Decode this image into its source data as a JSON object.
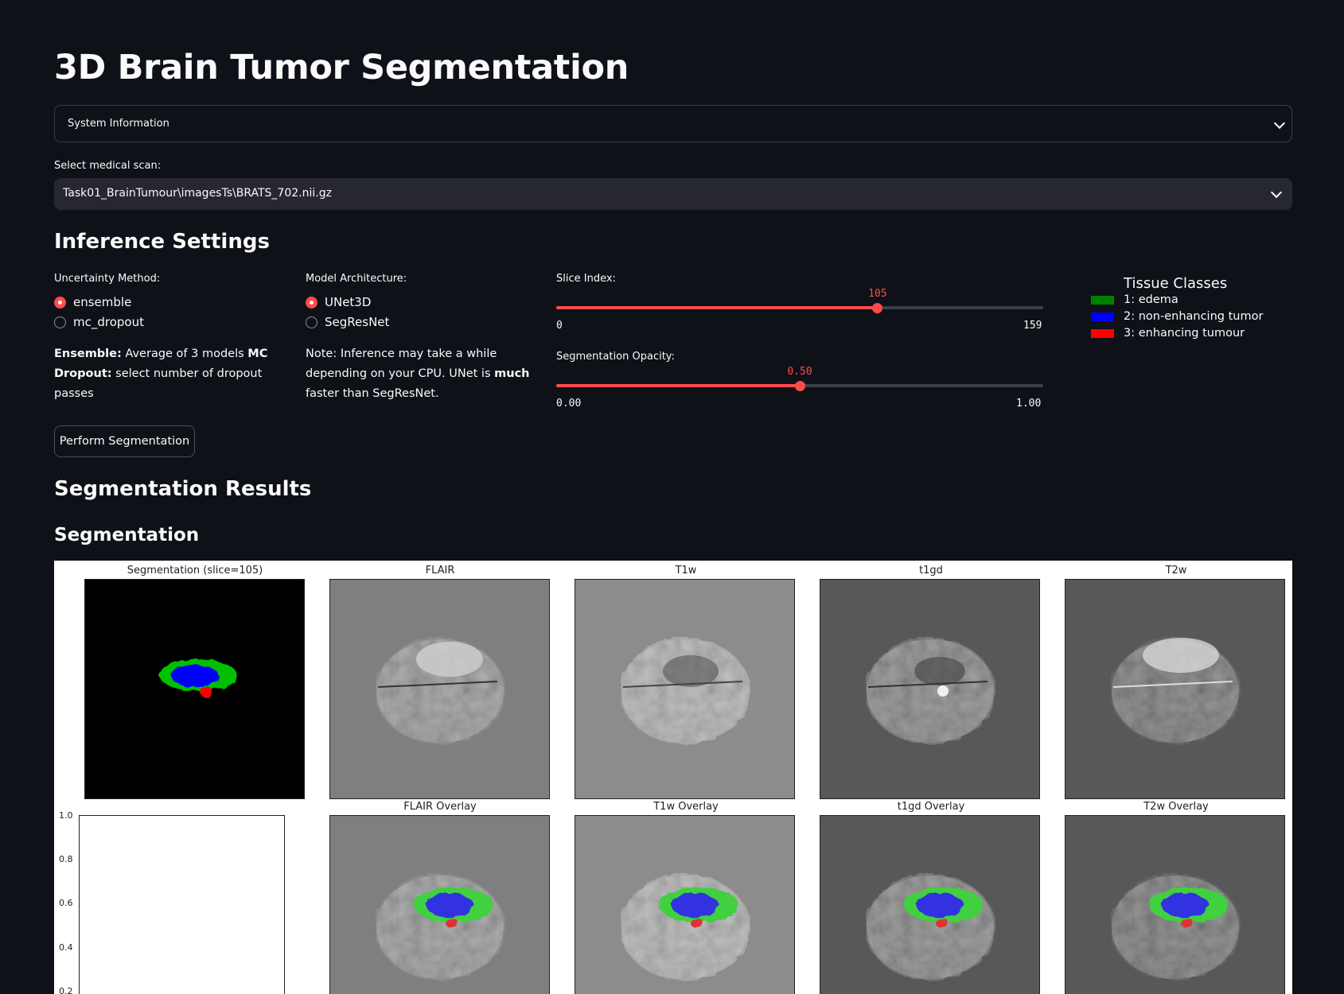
{
  "app": {
    "title": "3D Brain Tumor Segmentation"
  },
  "system_info": {
    "label": "System Information"
  },
  "scan_select": {
    "label": "Select medical scan:",
    "value": "Task01_BrainTumour\\imagesTs\\BRATS_702.nii.gz"
  },
  "inference": {
    "heading": "Inference Settings",
    "uncertainty": {
      "label": "Uncertainty Method:",
      "options": [
        "ensemble",
        "mc_dropout"
      ],
      "selected": "ensemble",
      "note_bold1": "Ensemble:",
      "note_text1": " Average of 3 models ",
      "note_bold2": "MC Dropout:",
      "note_text2": " select number of dropout passes"
    },
    "model": {
      "label": "Model Architecture:",
      "options": [
        "UNet3D",
        "SegResNet"
      ],
      "selected": "UNet3D",
      "note_text1": "Note: Inference may take a while depending on your CPU. UNet is ",
      "note_bold": "much",
      "note_text2": " faster than SegResNet."
    },
    "slice": {
      "label": "Slice Index:",
      "value": "105",
      "min": "0",
      "max": "159",
      "fraction": 0.66
    },
    "opacity": {
      "label": "Segmentation Opacity:",
      "value": "0.50",
      "min": "0.00",
      "max": "1.00",
      "fraction": 0.5
    }
  },
  "legend": {
    "title": "Tissue Classes",
    "items": [
      {
        "label": "1: edema",
        "color": "#008000"
      },
      {
        "label": "2: non-enhancing tumor",
        "color": "#0000ff"
      },
      {
        "label": "3: enhancing tumour",
        "color": "#ff0000"
      }
    ]
  },
  "perform_button": "Perform Segmentation",
  "results": {
    "heading": "Segmentation Results",
    "subheading": "Segmentation"
  },
  "figure": {
    "titles_row1": [
      "Segmentation (slice=105)",
      "FLAIR",
      "T1w",
      "t1gd",
      "T2w"
    ],
    "titles_row2": [
      "FLAIR Overlay",
      "T1w Overlay",
      "t1gd Overlay",
      "T2w Overlay"
    ],
    "yticks": [
      "1.0",
      "0.8",
      "0.6",
      "0.4",
      "0.2"
    ],
    "colors": {
      "accent": "#ff4b4b",
      "background": "#0e1117"
    }
  }
}
